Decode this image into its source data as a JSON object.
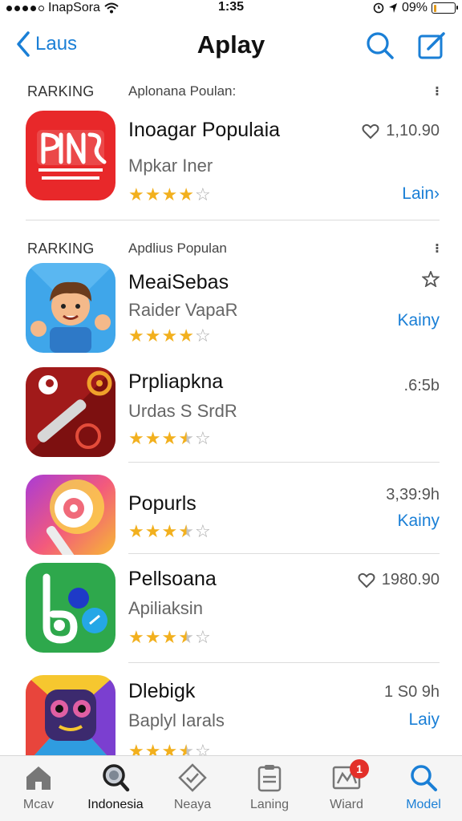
{
  "status_bar": {
    "carrier": "InapSora",
    "time": "1:35",
    "battery": "09%",
    "battery_level": 0.09
  },
  "nav": {
    "back_label": "Laus",
    "title": "Aplay"
  },
  "sections": [
    {
      "rank_label": "RARKING",
      "subtitle": "Aplonana Poulan:",
      "more": "⁝"
    },
    {
      "rank_label": "RARKING",
      "subtitle": "Apdlius Populan",
      "more": "⁝"
    }
  ],
  "apps": [
    {
      "name": "Inoagar Populaia",
      "developer": "Mpkar Iner",
      "rating": 4,
      "meta_icon": "heart-icon",
      "meta_value": "1,10.90",
      "action": "Lain›"
    },
    {
      "name": "MeaiSebas",
      "developer": "Raider VapaR",
      "rating": 4,
      "meta_icon": "star-outline-icon",
      "meta_value": "",
      "action": "Kainy"
    },
    {
      "name": "Prpliapkna",
      "developer": "Urdas S SrdR",
      "rating": 3.5,
      "meta_icon": "",
      "meta_value": ".6:5b",
      "action": ""
    },
    {
      "name": "Popurls",
      "developer": "",
      "rating": 3.5,
      "meta_icon": "",
      "meta_value": "3,39:9h",
      "action": "Kainy"
    },
    {
      "name": "Pellsoana",
      "developer": "Apiliaksin",
      "rating": 3.5,
      "meta_icon": "heart-icon",
      "meta_value": "1980.90",
      "action": ""
    },
    {
      "name": "Dlebigk",
      "developer": "Baplyl Iarals",
      "rating": 3.5,
      "meta_icon": "",
      "meta_value": "1 S0 9h",
      "action": "Laiy"
    }
  ],
  "tabs": [
    {
      "label": "Mcav",
      "icon": "home-icon"
    },
    {
      "label": "Indonesia",
      "icon": "search-magnifier-icon"
    },
    {
      "label": "Neaya",
      "icon": "diamond-icon"
    },
    {
      "label": "Laning",
      "icon": "clipboard-icon"
    },
    {
      "label": "Wiard",
      "icon": "message-icon",
      "badge": "1"
    },
    {
      "label": "Model",
      "icon": "search-icon"
    }
  ],
  "colors": {
    "accent": "#1a7fd6",
    "star": "#f2b01e",
    "badge": "#e3302a"
  }
}
